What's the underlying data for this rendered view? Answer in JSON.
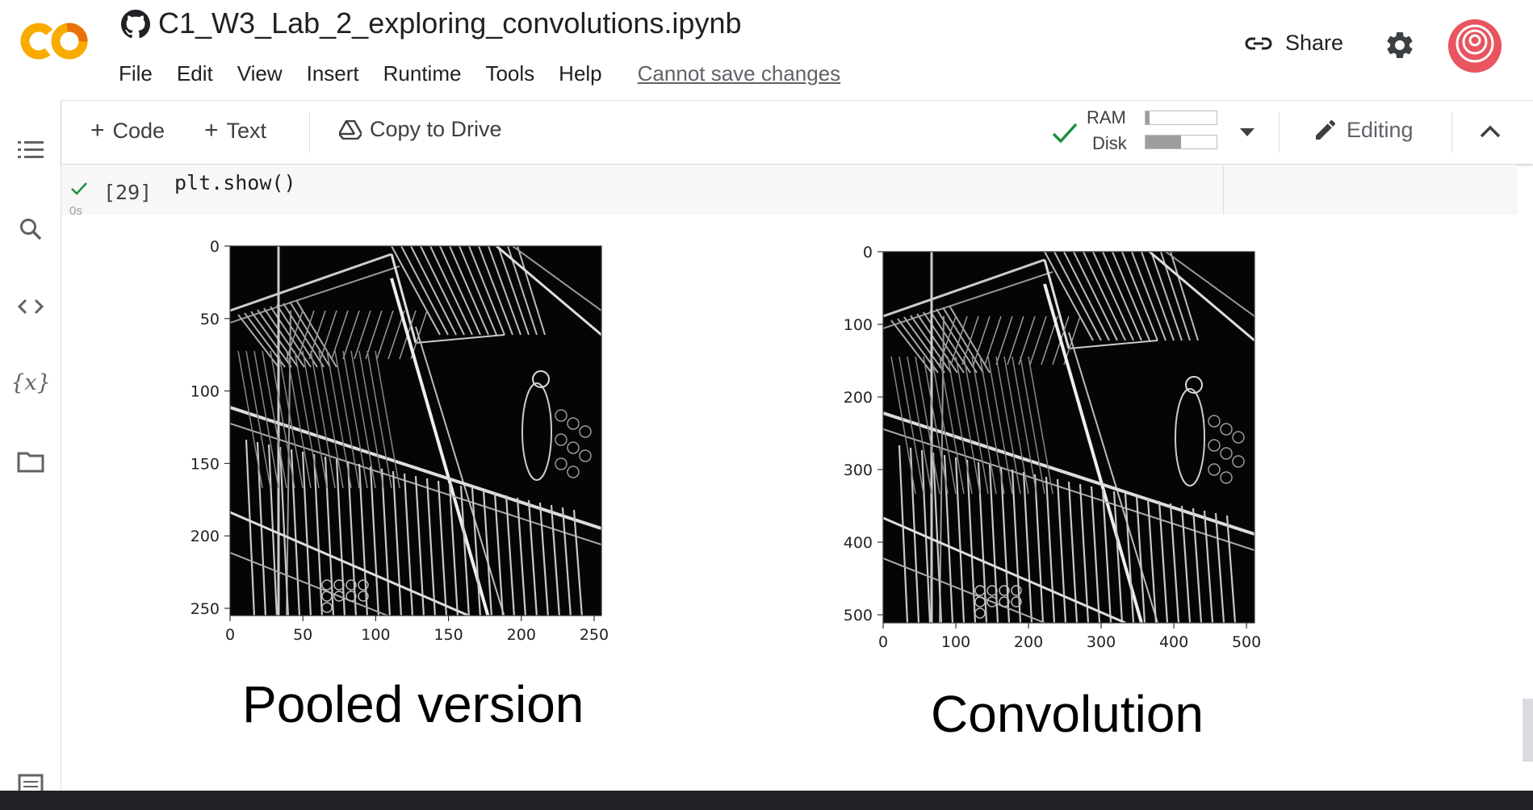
{
  "app": {
    "notebook_title": "C1_W3_Lab_2_exploring_convolutions.ipynb",
    "logo_text": "CO",
    "share_label": "Share",
    "status_link": "Cannot save changes"
  },
  "menu": [
    "File",
    "Edit",
    "View",
    "Insert",
    "Runtime",
    "Tools",
    "Help"
  ],
  "toolbar": {
    "code_label": "Code",
    "text_label": "Text",
    "copy_label": "Copy to Drive",
    "ram_label": "RAM",
    "disk_label": "Disk",
    "ram_usage": 0.06,
    "disk_usage": 0.5,
    "editing_label": "Editing"
  },
  "sidebar": {
    "icons": [
      "table-of-contents-icon",
      "search-icon",
      "code-snippets-icon",
      "variables-icon",
      "folder-icon",
      "terminal-icon"
    ],
    "variables_glyph": "{x}"
  },
  "cell": {
    "execution_count": "[29]",
    "exec_time": "0s",
    "code": "plt.show()"
  },
  "colors": {
    "accent_orange": "#F9AB00",
    "check_green": "#1e8e3e",
    "avatar_red": "#e8545f"
  },
  "chart_data": [
    {
      "type": "image",
      "caption": "Pooled version",
      "xticks": [
        "0",
        "50",
        "100",
        "150",
        "200",
        "250"
      ],
      "yticks": [
        "0",
        "50",
        "100",
        "150",
        "200",
        "250"
      ],
      "xlim": [
        0,
        255
      ],
      "ylim": [
        255,
        0
      ]
    },
    {
      "type": "image",
      "caption": "Convolution",
      "xticks": [
        "0",
        "100",
        "200",
        "300",
        "400",
        "500"
      ],
      "yticks": [
        "0",
        "100",
        "200",
        "300",
        "400",
        "500"
      ],
      "xlim": [
        0,
        511
      ],
      "ylim": [
        511,
        0
      ]
    }
  ]
}
